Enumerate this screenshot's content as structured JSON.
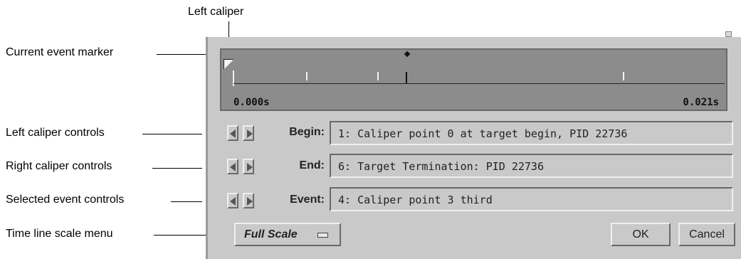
{
  "callouts": {
    "left_caliper": "Left caliper",
    "current_event_marker": "Current event marker",
    "left_caliper_controls": "Left caliper controls",
    "right_caliper_controls": "Right caliper controls",
    "selected_event_controls": "Selected event controls",
    "time_line_scale_menu": "Time line scale menu"
  },
  "timeline": {
    "start_label": "0.000s",
    "end_label": "0.021s"
  },
  "rows": {
    "begin": {
      "label": "Begin:",
      "value": "1: Caliper point 0 at target begin, PID 22736"
    },
    "end": {
      "label": "End:",
      "value": "6: Target Termination: PID 22736"
    },
    "event": {
      "label": "Event:",
      "value": "4: Caliper point 3 third"
    }
  },
  "scale_menu": {
    "label": "Full Scale"
  },
  "buttons": {
    "ok": "OK",
    "cancel": "Cancel"
  },
  "icons": {
    "prev": "left-arrow-icon",
    "next": "right-arrow-icon",
    "caliper": "caliper-marker-icon",
    "marker": "diamond-marker-icon",
    "menu": "option-menu-indicator-icon"
  }
}
